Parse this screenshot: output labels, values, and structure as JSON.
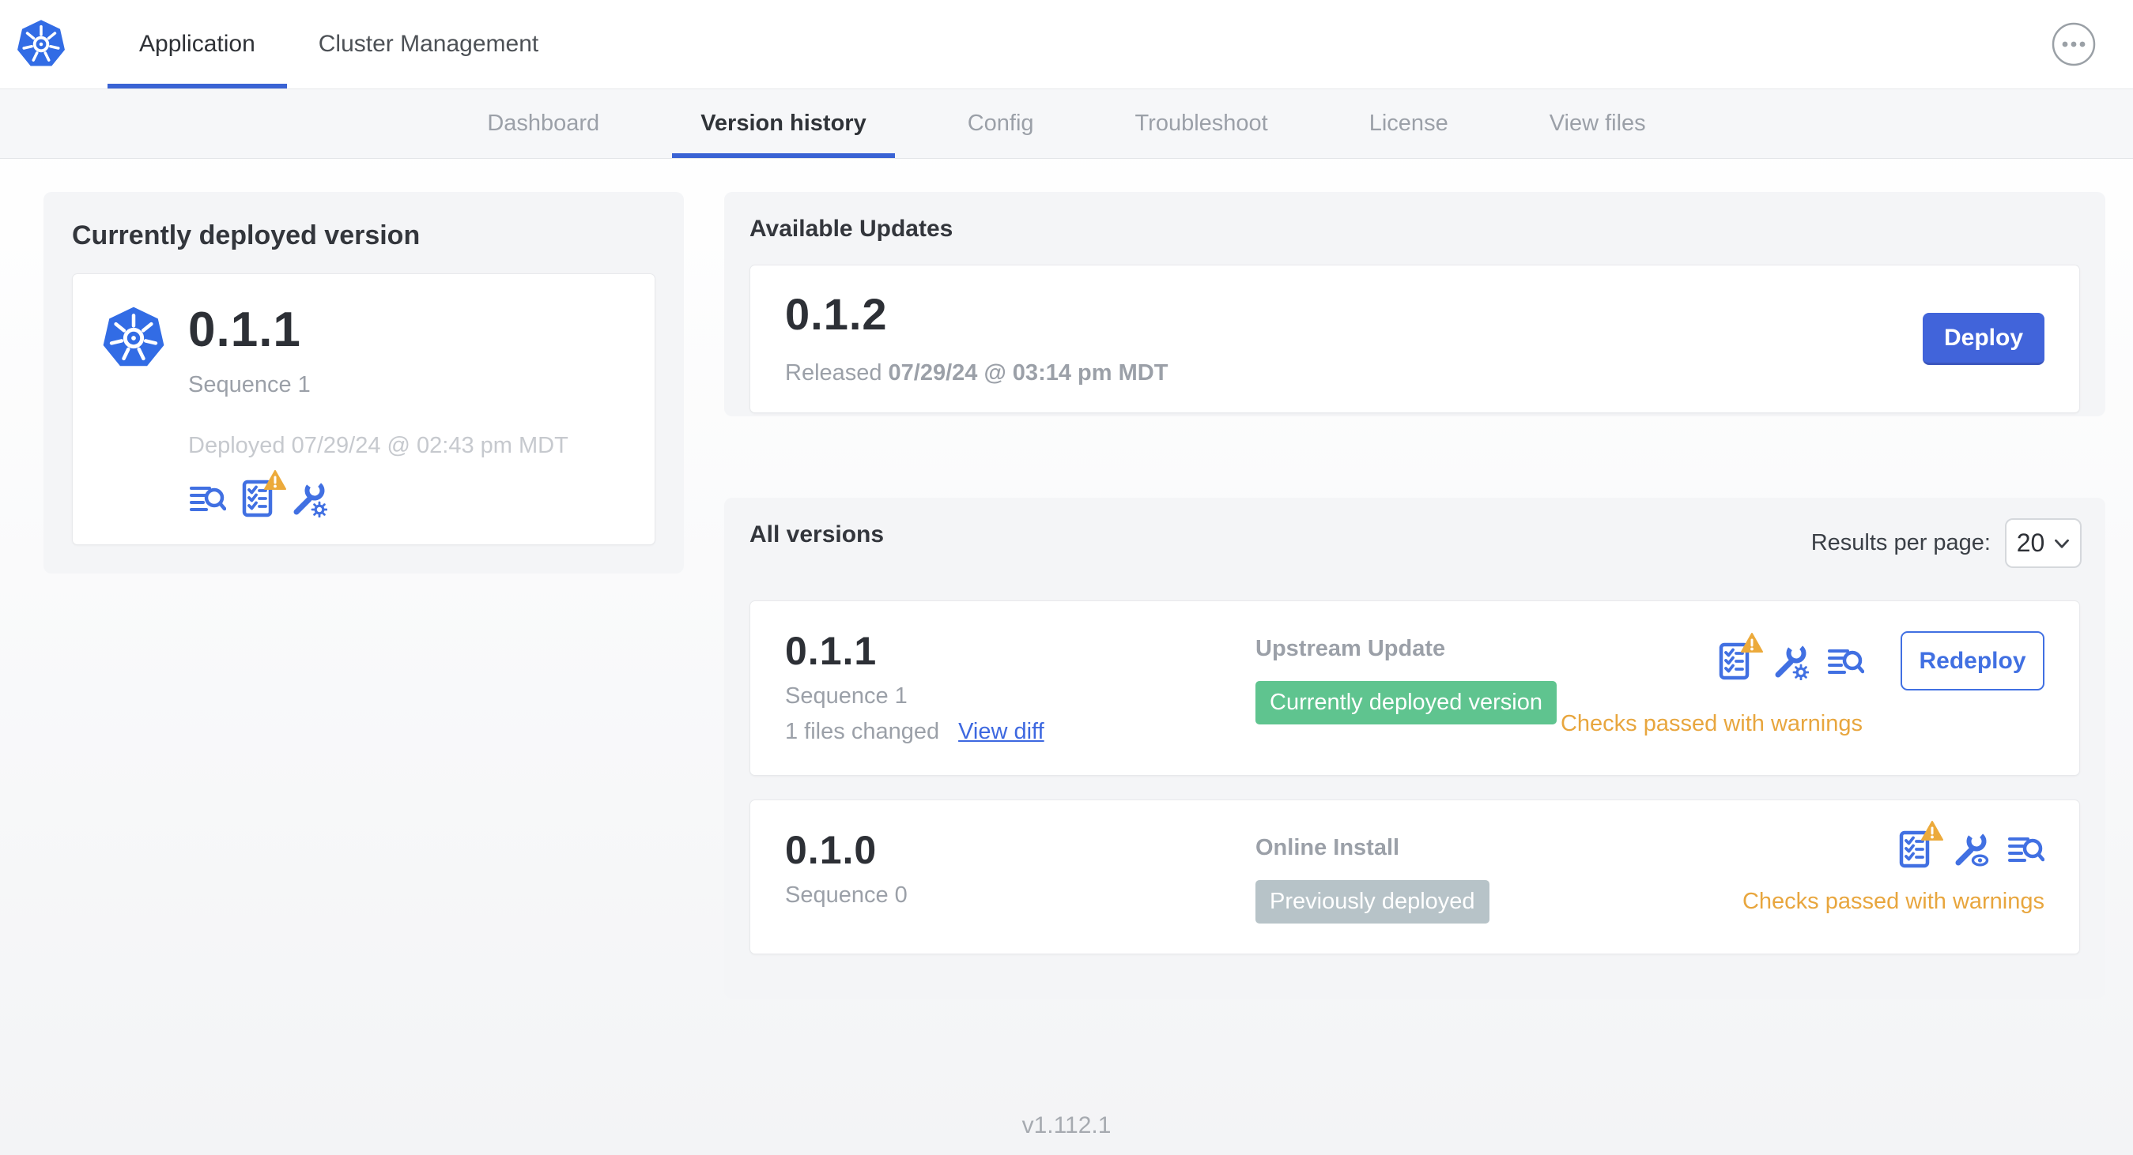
{
  "header": {
    "tabs": [
      {
        "label": "Application",
        "active": true
      },
      {
        "label": "Cluster Management",
        "active": false
      }
    ],
    "more_icon": "ellipsis-icon",
    "logo_icon": "kubernetes-logo"
  },
  "subnav": {
    "tabs": [
      {
        "label": "Dashboard",
        "active": false
      },
      {
        "label": "Version history",
        "active": true
      },
      {
        "label": "Config",
        "active": false
      },
      {
        "label": "Troubleshoot",
        "active": false
      },
      {
        "label": "License",
        "active": false
      },
      {
        "label": "View files",
        "active": false
      }
    ]
  },
  "currently_deployed": {
    "title": "Currently deployed version",
    "version": "0.1.1",
    "sequence": "Sequence 1",
    "deployed": "Deployed 07/29/24 @ 02:43 pm MDT",
    "icons": [
      "view-diff-icon",
      "preflight-checks-warning-icon",
      "edit-config-icon"
    ]
  },
  "available_updates": {
    "title": "Available Updates",
    "version": "0.1.2",
    "released_label": "Released",
    "released_date": "07/29/24 @ 03:14 pm MDT",
    "deploy_label": "Deploy"
  },
  "all_versions": {
    "title": "All versions",
    "results_per_page_label": "Results per page:",
    "results_per_page_value": "20",
    "rows": [
      {
        "version": "0.1.1",
        "sequence": "Sequence 1",
        "files_changed": "1 files changed",
        "view_diff_label": "View diff",
        "source": "Upstream Update",
        "badge": "Currently deployed version",
        "badge_color": "#5fc48f",
        "icons": [
          "preflight-checks-warning-icon",
          "edit-config-icon",
          "view-diff-icon"
        ],
        "action_label": "Redeploy",
        "status": "Checks passed with warnings"
      },
      {
        "version": "0.1.0",
        "sequence": "Sequence 0",
        "source": "Online Install",
        "badge": "Previously deployed",
        "badge_color": "#b7c3c8",
        "icons": [
          "preflight-checks-warning-icon",
          "view-config-icon",
          "view-diff-icon"
        ],
        "status": "Checks passed with warnings"
      }
    ]
  },
  "footer": {
    "version": "v1.112.1"
  },
  "colors": {
    "accent_blue": "#4170e2",
    "deploy_blue": "#4164da",
    "tab_underline_blue": "#3a63d4",
    "badge_green": "#5fc48f",
    "badge_gray": "#b7c3c8",
    "warning_orange": "#e8a63e",
    "kubernetes_blue": "#326ce5"
  }
}
